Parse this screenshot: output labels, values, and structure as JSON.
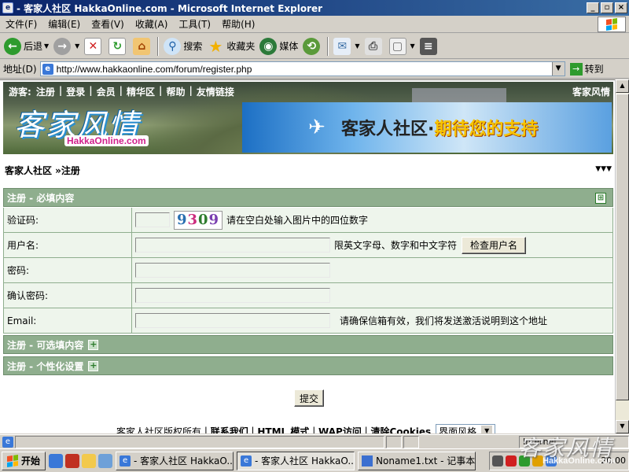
{
  "window": {
    "title": "- 客家人社区 HakkaOnline.com - Microsoft Internet Explorer",
    "min": "_",
    "max": "▫",
    "close": "×"
  },
  "menu": [
    "文件(F)",
    "编辑(E)",
    "查看(V)",
    "收藏(A)",
    "工具(T)",
    "帮助(H)"
  ],
  "toolbar": {
    "back": "后退",
    "search": "搜索",
    "favorites": "收藏夹",
    "media": "媒体"
  },
  "address": {
    "label": "地址(D)",
    "url": "http://www.hakkaonline.com/forum/register.php",
    "go": "转到"
  },
  "site": {
    "nav": [
      "游客:",
      "注册",
      "登录",
      "会员",
      "精华区",
      "帮助",
      "友情链接"
    ],
    "top_right": "客家风情",
    "logo": "客家风情",
    "logo_url": "HakkaOnline.com",
    "slogan_main": "客家人社区·",
    "slogan_accent": "期待您的支持"
  },
  "breadcrumb": "客家人社区 »注册",
  "sections": {
    "required": "注册 - 必填内容",
    "optional": "注册 - 可选填内容",
    "personal": "注册 - 个性化设置"
  },
  "form": {
    "captcha_label": "验证码:",
    "captcha_hint": "请在空白处输入图片中的四位数字",
    "captcha_digits": [
      "9",
      "3",
      "0",
      "9"
    ],
    "username_label": "用户名:",
    "username_hint": "限英文字母、数字和中文字符",
    "check_button": "检查用户名",
    "password_label": "密码:",
    "confirm_label": "确认密码:",
    "email_label": "Email:",
    "email_hint": "请确保信箱有效，我们将发送激活说明到这个地址",
    "submit": "提交"
  },
  "footer": {
    "copyright": "客家人社区版权所有",
    "contact": "联系我们",
    "html": "HTML 模式",
    "wap": "WAP访问",
    "cookies": "清除Cookies",
    "style_select": "界面风格"
  },
  "status": {
    "zone": "Internet"
  },
  "taskbar": {
    "start": "开始",
    "tasks": [
      "- 客家人社区 HakkaO...",
      "- 客家人社区 HakkaO...",
      "Noname1.txt - 记事本"
    ],
    "clock": "20:00"
  },
  "watermark": {
    "text": "客家风情",
    "url": "HakkaOnline.com"
  },
  "colors": {
    "section_green": "#8fae8e",
    "row_bg": "#eef5ec",
    "title_blue": "#0a246a"
  }
}
